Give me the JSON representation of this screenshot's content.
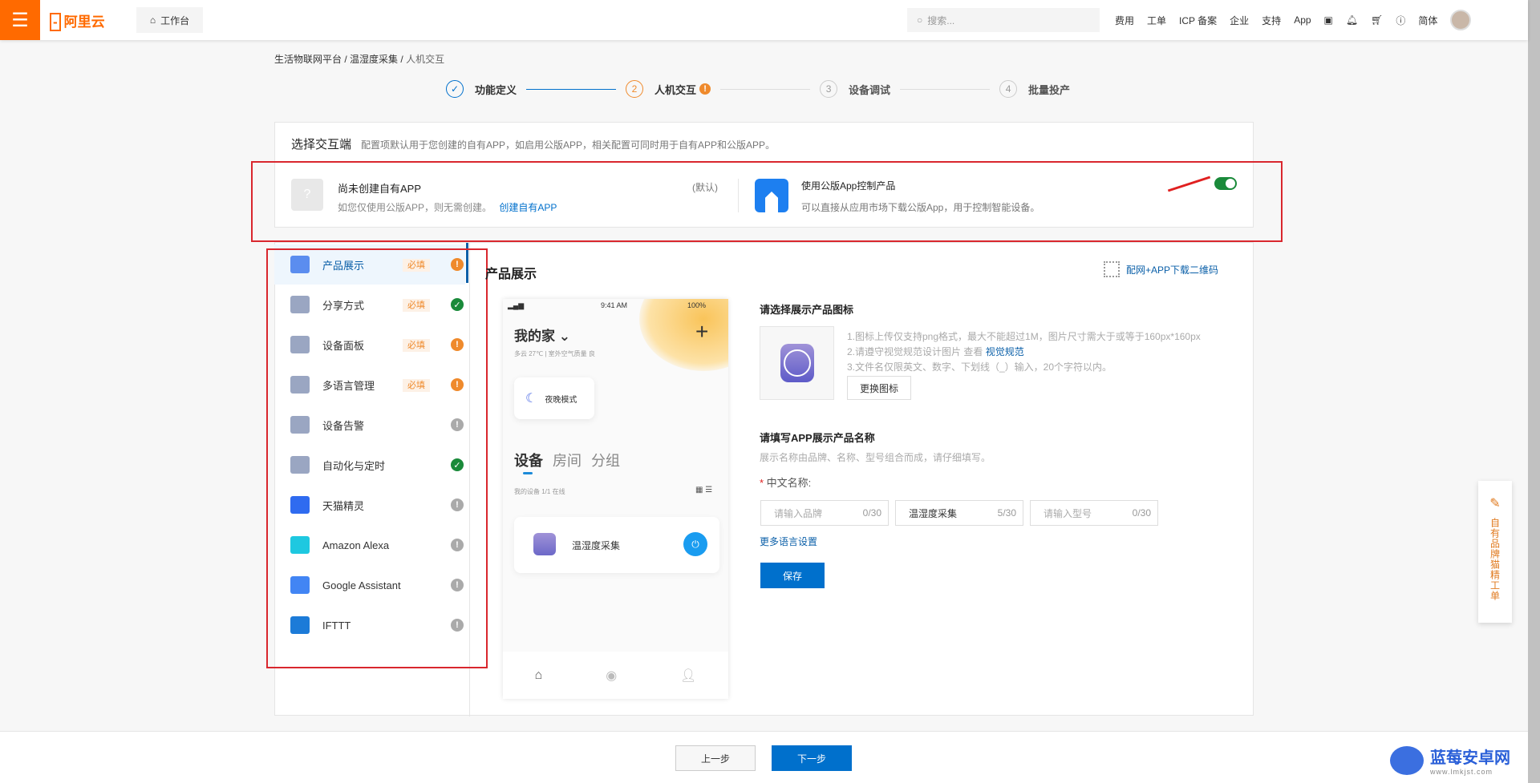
{
  "header": {
    "logo": "阿里云",
    "workbench": "工作台",
    "search_placeholder": "搜索...",
    "nav": [
      "费用",
      "工单",
      "ICP 备案",
      "企业",
      "支持",
      "App"
    ],
    "lang": "简体"
  },
  "breadcrumb": [
    "生活物联网平台",
    "温湿度采集",
    "人机交互"
  ],
  "steps": [
    {
      "num": "✓",
      "label": "功能定义",
      "state": "done"
    },
    {
      "num": "2",
      "label": "人机交互",
      "state": "current"
    },
    {
      "num": "3",
      "label": "设备调试",
      "state": "todo"
    },
    {
      "num": "4",
      "label": "批量投产",
      "state": "todo"
    }
  ],
  "select": {
    "title": "选择交互端",
    "desc": "配置项默认用于您创建的自有APP，如启用公版APP，相关配置可同时用于自有APP和公版APP。",
    "own": {
      "title": "尚未创建自有APP",
      "default": "(默认)",
      "desc": "如您仅使用公版APP，则无需创建。",
      "link": "创建自有APP"
    },
    "public": {
      "title": "使用公版App控制产品",
      "desc": "可以直接从应用市场下载公版App，用于控制智能设备。",
      "enabled": true
    }
  },
  "sidebar": {
    "items": [
      {
        "label": "产品展示",
        "required": "必填",
        "status": "warn",
        "color": "#5b8def"
      },
      {
        "label": "分享方式",
        "required": "必填",
        "status": "ok",
        "color": "#9aa6c2"
      },
      {
        "label": "设备面板",
        "required": "必填",
        "status": "warn",
        "color": "#9aa6c2"
      },
      {
        "label": "多语言管理",
        "required": "必填",
        "status": "warn",
        "color": "#9aa6c2"
      },
      {
        "label": "设备告警",
        "required": "",
        "status": "info",
        "color": "#9aa6c2"
      },
      {
        "label": "自动化与定时",
        "required": "",
        "status": "ok",
        "color": "#9aa6c2"
      },
      {
        "label": "天猫精灵",
        "required": "",
        "status": "info",
        "color": "#2f6bf0"
      },
      {
        "label": "Amazon Alexa",
        "required": "",
        "status": "info",
        "color": "#1ec8e0"
      },
      {
        "label": "Google Assistant",
        "required": "",
        "status": "info",
        "color": "#4285f4"
      },
      {
        "label": "IFTTT",
        "required": "",
        "status": "info",
        "color": "#1c7bd8"
      }
    ]
  },
  "content": {
    "title": "产品展示",
    "qr_link": "配网+APP下载二维码",
    "phone": {
      "time": "9:41 AM",
      "battery": "100%",
      "home": "我的家",
      "weather": "多云 27℃  |  室外空气质量 良",
      "scene": "夜晚模式",
      "tabs": [
        "设备",
        "房间",
        "分组"
      ],
      "mydev": "我的设备   1/1 在线",
      "device": "温湿度采集"
    },
    "icon_section": {
      "title": "请选择展示产品图标",
      "rules": [
        "1.图标上传仅支持png格式，最大不能超过1M，图片尺寸需大于或等于160px*160px",
        "2.请遵守视觉规范设计图片 查看 ",
        "3.文件名仅限英文、数字、下划线（_）输入，20个字符以内。"
      ],
      "rule_link": "视觉规范",
      "change": "更换图标"
    },
    "name_section": {
      "title": "请填写APP展示产品名称",
      "desc": "展示名称由品牌、名称、型号组合而成，请仔细填写。",
      "label": "中文名称:",
      "inputs": [
        {
          "placeholder": "请输入品牌",
          "value": "",
          "count": "0/30"
        },
        {
          "placeholder": "",
          "value": "温湿度采集",
          "count": "5/30"
        },
        {
          "placeholder": "请输入型号",
          "value": "",
          "count": "0/30"
        }
      ],
      "more": "更多语言设置",
      "save": "保存"
    }
  },
  "footer": {
    "prev": "上一步",
    "next": "下一步"
  },
  "float": {
    "label": "自有品牌猫精工单"
  },
  "watermark": {
    "text": "蓝莓安卓网",
    "url": "www.lmkjst.com"
  },
  "colors": {
    "brand": "#ff6a00",
    "primary": "#0070cc",
    "warn": "#ef8a2c",
    "ok": "#1a8a3a"
  }
}
